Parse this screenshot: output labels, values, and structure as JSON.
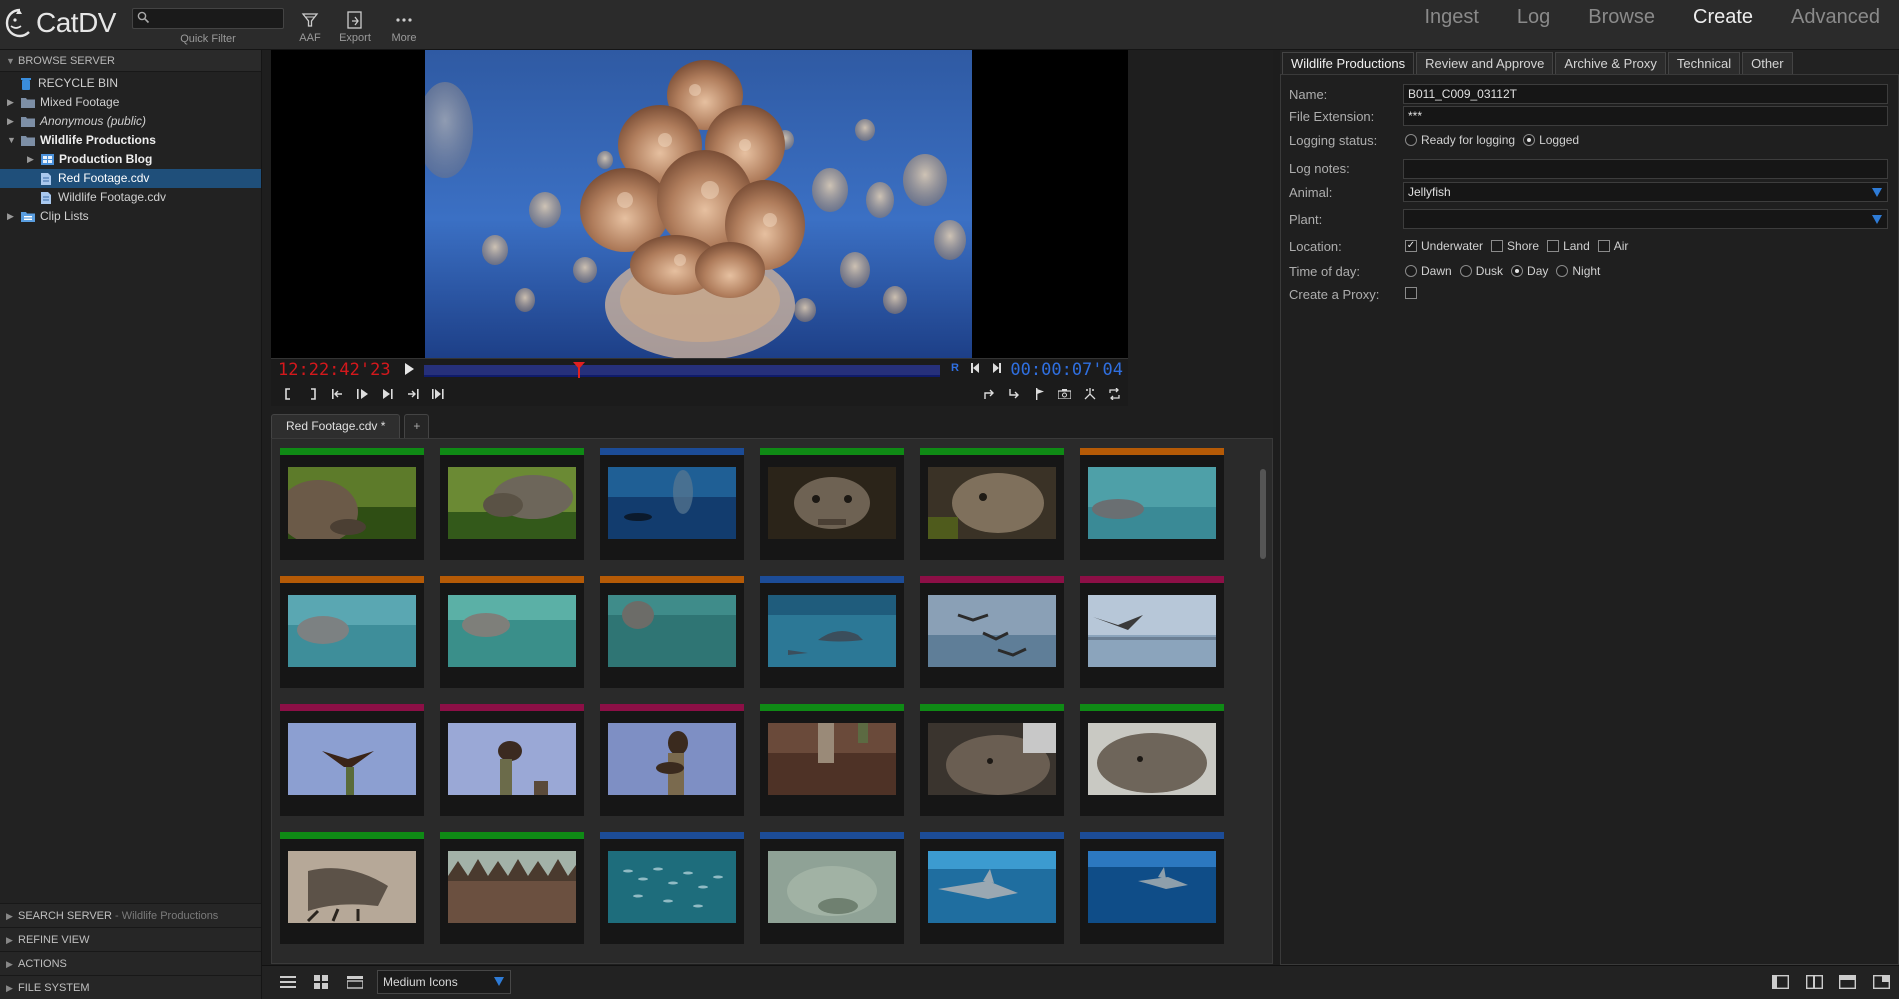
{
  "app": {
    "logo_text": "CatDV"
  },
  "toolbar": {
    "quick_filter_label": "Quick Filter",
    "quick_filter_value": "",
    "aaf_label": "AAF",
    "export_label": "Export",
    "more_label": "More"
  },
  "modes": [
    "Ingest",
    "Log",
    "Browse",
    "Create",
    "Advanced"
  ],
  "active_mode": "Create",
  "browse": {
    "header": "BROWSE SERVER",
    "items": [
      {
        "label": "RECYCLE BIN"
      },
      {
        "label": "Mixed Footage"
      },
      {
        "label": "Anonymous (public)"
      },
      {
        "label": "Wildlife Productions"
      },
      {
        "label": "Production Blog"
      },
      {
        "label": "Red Footage.cdv"
      },
      {
        "label": "Wildlife Footage.cdv"
      },
      {
        "label": "Clip Lists"
      }
    ]
  },
  "left_sections": {
    "search_label": "SEARCH SERVER",
    "search_sub": " - Wildlife Productions",
    "refine_label": "REFINE VIEW",
    "actions_label": "ACTIONS",
    "filesystem_label": "FILE SYSTEM"
  },
  "player": {
    "timecode_current": "12:22:42'23",
    "timecode_duration": "00:00:07'04",
    "playhead_fraction": 0.3,
    "r_label": "R"
  },
  "catalog": {
    "tab_label": "Red Footage.cdv *",
    "add_tab_label": "+",
    "view_mode": "Medium Icons",
    "clips": [
      {
        "color": "#0f8a15",
        "scene": "tortoise-grass"
      },
      {
        "color": "#0f8a15",
        "scene": "tortoise-grass2"
      },
      {
        "color": "#1c4c97",
        "scene": "underwater-sealion"
      },
      {
        "color": "#0f8a15",
        "scene": "tortoise-face"
      },
      {
        "color": "#0f8a15",
        "scene": "tortoise-face2"
      },
      {
        "color": "#b55a06",
        "scene": "sealion-water"
      },
      {
        "color": "#b55a06",
        "scene": "sealion-water2"
      },
      {
        "color": "#b55a06",
        "scene": "sealion-water3"
      },
      {
        "color": "#b55a06",
        "scene": "sealion-water4"
      },
      {
        "color": "#1c4c97",
        "scene": "dolphin"
      },
      {
        "color": "#8c0f46",
        "scene": "pelicans"
      },
      {
        "color": "#8c0f46",
        "scene": "pelican-fly"
      },
      {
        "color": "#8c0f46",
        "scene": "hawk-cactus"
      },
      {
        "color": "#8c0f46",
        "scene": "hawk-cactus2"
      },
      {
        "color": "#8c0f46",
        "scene": "hawk-cactus3"
      },
      {
        "color": "#0f8a15",
        "scene": "dry-land"
      },
      {
        "color": "#0f8a15",
        "scene": "iguana"
      },
      {
        "color": "#0f8a15",
        "scene": "iguana2"
      },
      {
        "color": "#0f8a15",
        "scene": "iguana-claw"
      },
      {
        "color": "#0f8a15",
        "scene": "iguana-spines"
      },
      {
        "color": "#1c4c97",
        "scene": "fish-school"
      },
      {
        "color": "#1c4c97",
        "scene": "murky-water"
      },
      {
        "color": "#1c4c97",
        "scene": "shark"
      },
      {
        "color": "#1c4c97",
        "scene": "shark-deep"
      }
    ]
  },
  "details": {
    "tabs": [
      "Wildlife Productions",
      "Review and Approve",
      "Archive & Proxy",
      "Technical",
      "Other"
    ],
    "active_tab": "Wildlife Productions",
    "fields": {
      "name_label": "Name:",
      "name_value": "B011_C009_03112T",
      "ext_label": "File Extension:",
      "ext_value": "***",
      "logging_label": "Logging status:",
      "logging_opt1": "Ready for logging",
      "logging_opt2": "Logged",
      "lognotes_label": "Log notes:",
      "lognotes_value": "",
      "animal_label": "Animal:",
      "animal_value": "Jellyfish",
      "plant_label": "Plant:",
      "plant_value": "",
      "location_label": "Location:",
      "loc_opt1": "Underwater",
      "loc_opt2": "Shore",
      "loc_opt3": "Land",
      "loc_opt4": "Air",
      "time_label": "Time of day:",
      "time_opt1": "Dawn",
      "time_opt2": "Dusk",
      "time_opt3": "Day",
      "time_opt4": "Night",
      "proxy_label": "Create a Proxy:"
    }
  },
  "colors": {
    "accent_blue": "#2e7bd6",
    "timecode_red": "#d4181c",
    "timecode_blue": "#2f6fe0",
    "selection": "#1f4f7a"
  }
}
